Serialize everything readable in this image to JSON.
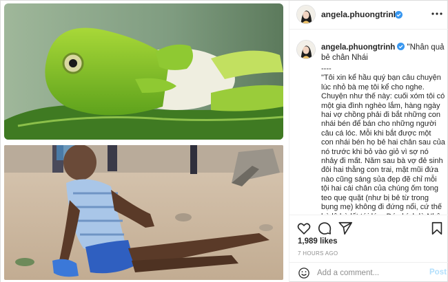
{
  "post": {
    "author": {
      "username": "angela.phuongtrinh",
      "verified": true
    },
    "caption": {
      "title": "\"Nhân quả bẻ chân Nhái",
      "body": "----\n\"Tôi xin kể hầu quý bạn câu chuyện lúc nhỏ bà mẹ tôi kể cho nghe. Chuyện như thế này: cuối xóm tôi có một gia đình nghèo lắm, hàng ngày hai vợ chồng phải đi bắt những con nhái bén để bán cho những người câu cá lóc. Mỗi khi bắt được một con nhái bén họ bẻ hai chân sau của nó trước khi bỏ vào giỏ vì sợ nó nhảy đi mất. Năm sau bà vợ đẻ sinh đôi hai thằng con trai, mặt mũi đứa nào cũng sáng sủa đẹp đẽ chỉ mỗi tội hai cái chân của chúng ốm tong teo quẹ quặt (như bị bẻ từ trong bụng mẹ) không đi đứng nổi, cứ thế bò lê bò lết tới lớn. Đó chính là Nhân Quả mà tôi đã làm hại những con nhái bén bị bẻ chân lúc còn nhỏ.\""
    },
    "likes": "1,989 likes",
    "time_ago": "7 HOURS AGO",
    "comment_box": {
      "placeholder": "Add a comment...",
      "post_label": "Post"
    },
    "icons": {
      "more": "more-horizontal-icon",
      "like": "heart-icon",
      "comment": "comment-bubble-icon",
      "share": "paper-plane-icon",
      "save": "bookmark-icon",
      "emoji": "smiley-icon",
      "verified": "verified-badge-icon"
    },
    "colors": {
      "verified": "#3897f0",
      "post_disabled": "#b2dffc",
      "muted": "#8e8e8e"
    }
  }
}
